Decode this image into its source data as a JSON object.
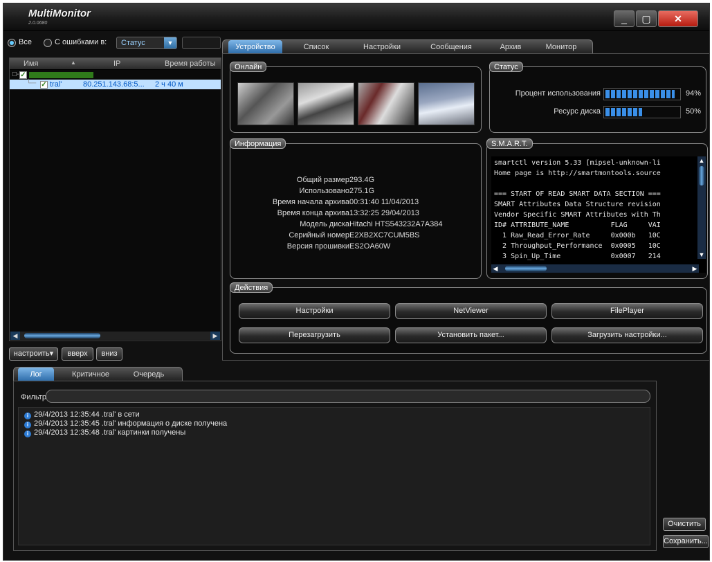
{
  "window": {
    "title": "MultiMonitor",
    "version": "2.0.0680",
    "min_glyph": "_",
    "max_glyph": "▢",
    "close_glyph": "✕"
  },
  "filter": {
    "all_label": "Все",
    "errors_label": "С ошибками в:",
    "status_value": "Статус",
    "combo_arrow": "▼"
  },
  "tree": {
    "columns": [
      "Имя",
      "IP",
      "Время работы"
    ],
    "sort_indicator": "▲",
    "root_expander": "□-",
    "check_glyph": "✓",
    "branch_glyph": "└─",
    "rows": [
      {
        "name": "tral'",
        "ip": "80.251.143.68:5...",
        "uptime": "2 ч 40 м"
      }
    ]
  },
  "left_buttons": {
    "configure": "настроить",
    "configure_caret": "▾",
    "up": "вверх",
    "down": "вниз"
  },
  "scroll": {
    "left": "◀",
    "right": "▶",
    "up": "▲",
    "down": "▼"
  },
  "tabs": [
    "Устройство",
    "Список",
    "Настройки",
    "Сообщения",
    "Архив",
    "Монитор"
  ],
  "online": {
    "title": "Онлайн"
  },
  "status": {
    "title": "Статус",
    "usage_label": "Процент использования",
    "usage_value": 94,
    "usage_text": "94%",
    "disk_label": "Ресурс диска",
    "disk_value": 50,
    "disk_text": "50%"
  },
  "info": {
    "title": "Информация",
    "rows": [
      {
        "label": "Общий размер",
        "value": "293.4G"
      },
      {
        "label": "Использовано",
        "value": "275.1G"
      },
      {
        "label": "Время начала архива",
        "value": "00:31:40 11/04/2013"
      },
      {
        "label": "Время конца архива",
        "value": "13:32:25 29/04/2013"
      },
      {
        "label": "Модель диска",
        "value": "Hitachi HTS543232A7A384"
      },
      {
        "label": "Серийный номер",
        "value": "E2XB2XC7CUM5BS"
      },
      {
        "label": "Версия прошивки",
        "value": "ES2OA60W"
      }
    ]
  },
  "smart": {
    "title": "S.M.A.R.T.",
    "lines": [
      "smartctl version 5.33 [mipsel-unknown-li",
      "Home page is http://smartmontools.source",
      "",
      "=== START OF READ SMART DATA SECTION ===",
      "SMART Attributes Data Structure revision",
      "Vendor Specific SMART Attributes with Th",
      "ID# ATTRIBUTE_NAME          FLAG     VAI",
      "  1 Raw_Read_Error_Rate     0x000b   10C",
      "  2 Throughput_Performance  0x0005   10C",
      "  3 Spin_Up_Time            0x0007   214"
    ]
  },
  "actions": {
    "title": "Действия",
    "buttons": [
      "Настройки",
      "NetViewer",
      "FilePlayer",
      "Перезагрузить",
      "Установить пакет...",
      "Загрузить настройки..."
    ]
  },
  "log_tabs": [
    "Лог",
    "Критичное",
    "Очередь"
  ],
  "log": {
    "filter_label": "Фильтр",
    "info_glyph": "i",
    "entries": [
      "29/4/2013 12:35:44 .tral' в сети",
      "29/4/2013 12:35:45 .tral' информация о диске получена",
      "29/4/2013 12:35:48 .tral' картинки получены"
    ],
    "clear_button": "Очистить",
    "save_button": "Сохранить..."
  }
}
